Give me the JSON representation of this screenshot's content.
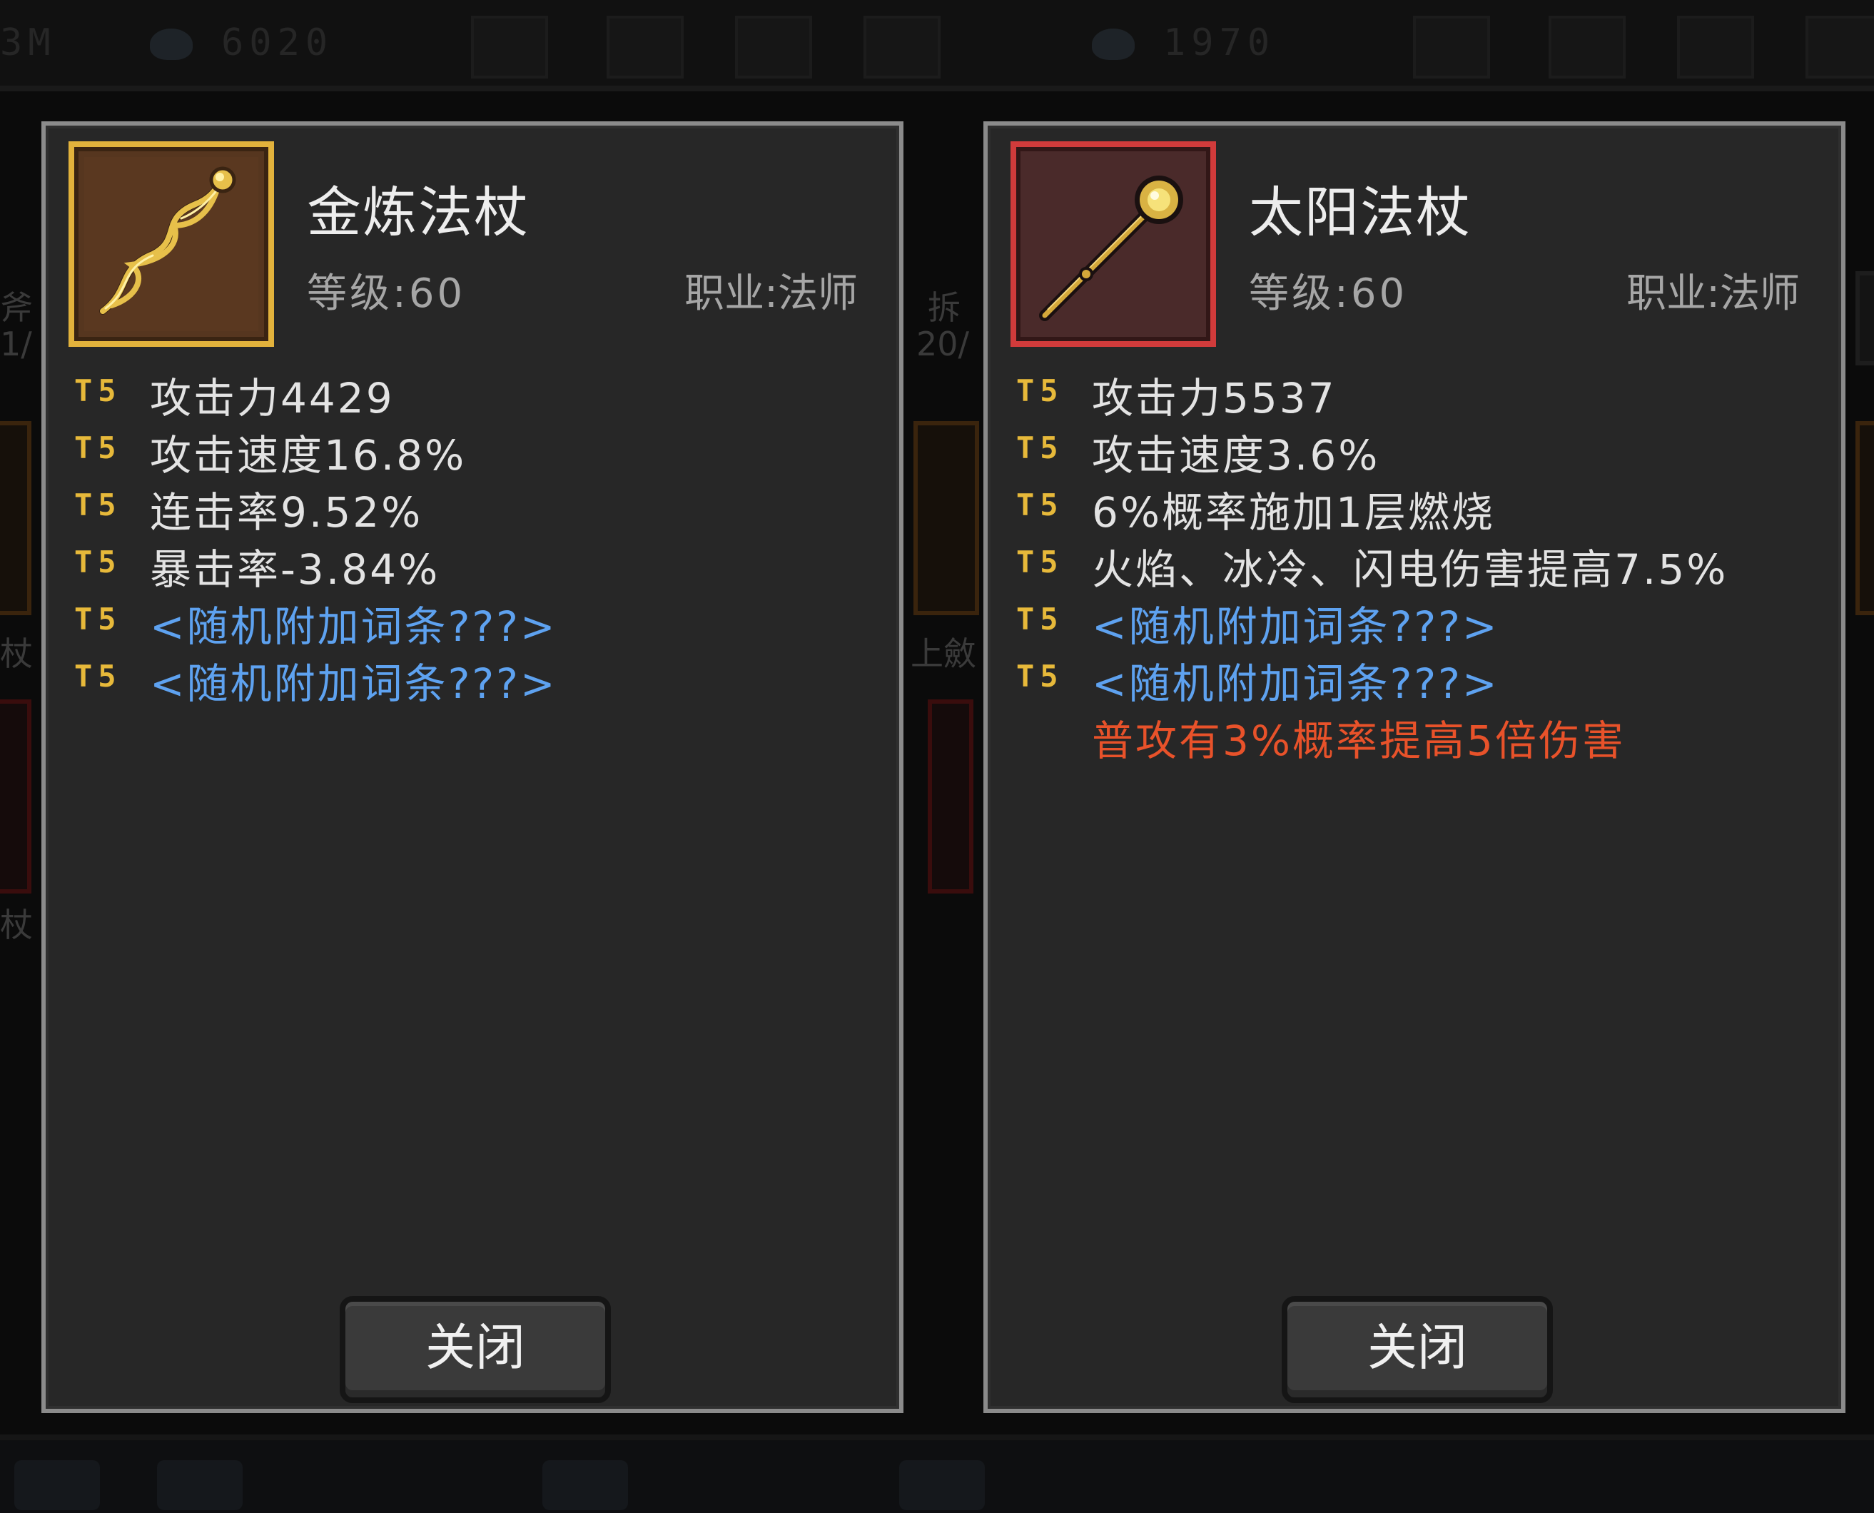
{
  "background": {
    "top_bar": {
      "left_count_partial": "3M",
      "left_resource": "6020",
      "right_resource": "1970"
    },
    "side_labels": {
      "left_top": "斧",
      "left_sub": "1/",
      "left_mid": "杖",
      "left_low": "杖",
      "mid_top": "拆",
      "mid_sub": "20/",
      "mid_mid": "上斂"
    }
  },
  "panels": [
    {
      "id": "left",
      "icon": "golden-twisted-staff-icon",
      "frame_color": "#e2b23c",
      "name": "金炼法杖",
      "level_label": "等级:60",
      "class_label": "职业:法师",
      "stats": [
        {
          "tier": "T5",
          "text": "攻击力4429",
          "kind": "normal"
        },
        {
          "tier": "T5",
          "text": "攻击速度16.8%",
          "kind": "normal"
        },
        {
          "tier": "T5",
          "text": "连击率9.52%",
          "kind": "normal"
        },
        {
          "tier": "T5",
          "text": "暴击率-3.84%",
          "kind": "normal"
        },
        {
          "tier": "T5",
          "text": "<随机附加词条???>",
          "kind": "random"
        },
        {
          "tier": "T5",
          "text": "<随机附加词条???>",
          "kind": "random"
        }
      ],
      "close_label": "关闭"
    },
    {
      "id": "right",
      "icon": "sun-staff-icon",
      "frame_color": "#d13b3b",
      "name": "太阳法杖",
      "level_label": "等级:60",
      "class_label": "职业:法师",
      "stats": [
        {
          "tier": "T5",
          "text": "攻击力5537",
          "kind": "normal"
        },
        {
          "tier": "T5",
          "text": "攻击速度3.6%",
          "kind": "normal"
        },
        {
          "tier": "T5",
          "text": "6%概率施加1层燃烧",
          "kind": "normal"
        },
        {
          "tier": "T5",
          "text": "火焰、冰冷、闪电伤害提高7.5%",
          "kind": "normal"
        },
        {
          "tier": "T5",
          "text": "<随机附加词条???>",
          "kind": "random"
        },
        {
          "tier": "T5",
          "text": "<随机附加词条???>",
          "kind": "random"
        },
        {
          "tier": "",
          "text": "普攻有3%概率提高5倍伤害",
          "kind": "special"
        }
      ],
      "close_label": "关闭"
    }
  ],
  "colors": {
    "tier": "#e7b93a",
    "random_affix": "#5ea2f0",
    "special_affix": "#e8522a",
    "panel_bg": "#272727",
    "panel_border": "#8b8b8b"
  }
}
